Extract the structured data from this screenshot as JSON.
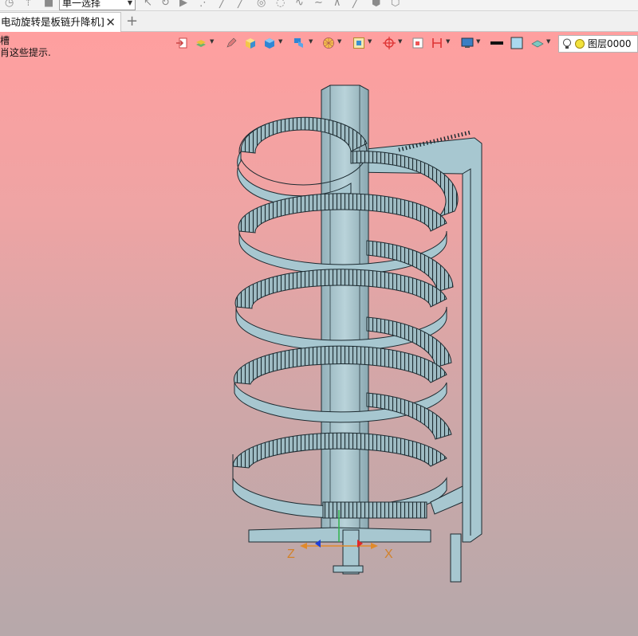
{
  "toolbar": {
    "select_mode": "单一选择"
  },
  "tab": {
    "title": "电动旋转是板链升降机]",
    "close": "✕",
    "add": "+"
  },
  "hint": {
    "line1": "槽",
    "line2": "肖这些提示."
  },
  "layer": {
    "label": "图层0000"
  },
  "axes": {
    "z": "Z",
    "x": "X"
  },
  "colors": {
    "viewport_top": "#ff9f9f",
    "viewport_bottom": "#b6a8aa",
    "model_fill": "#a7c7d0",
    "model_edge": "#1c2a30"
  }
}
